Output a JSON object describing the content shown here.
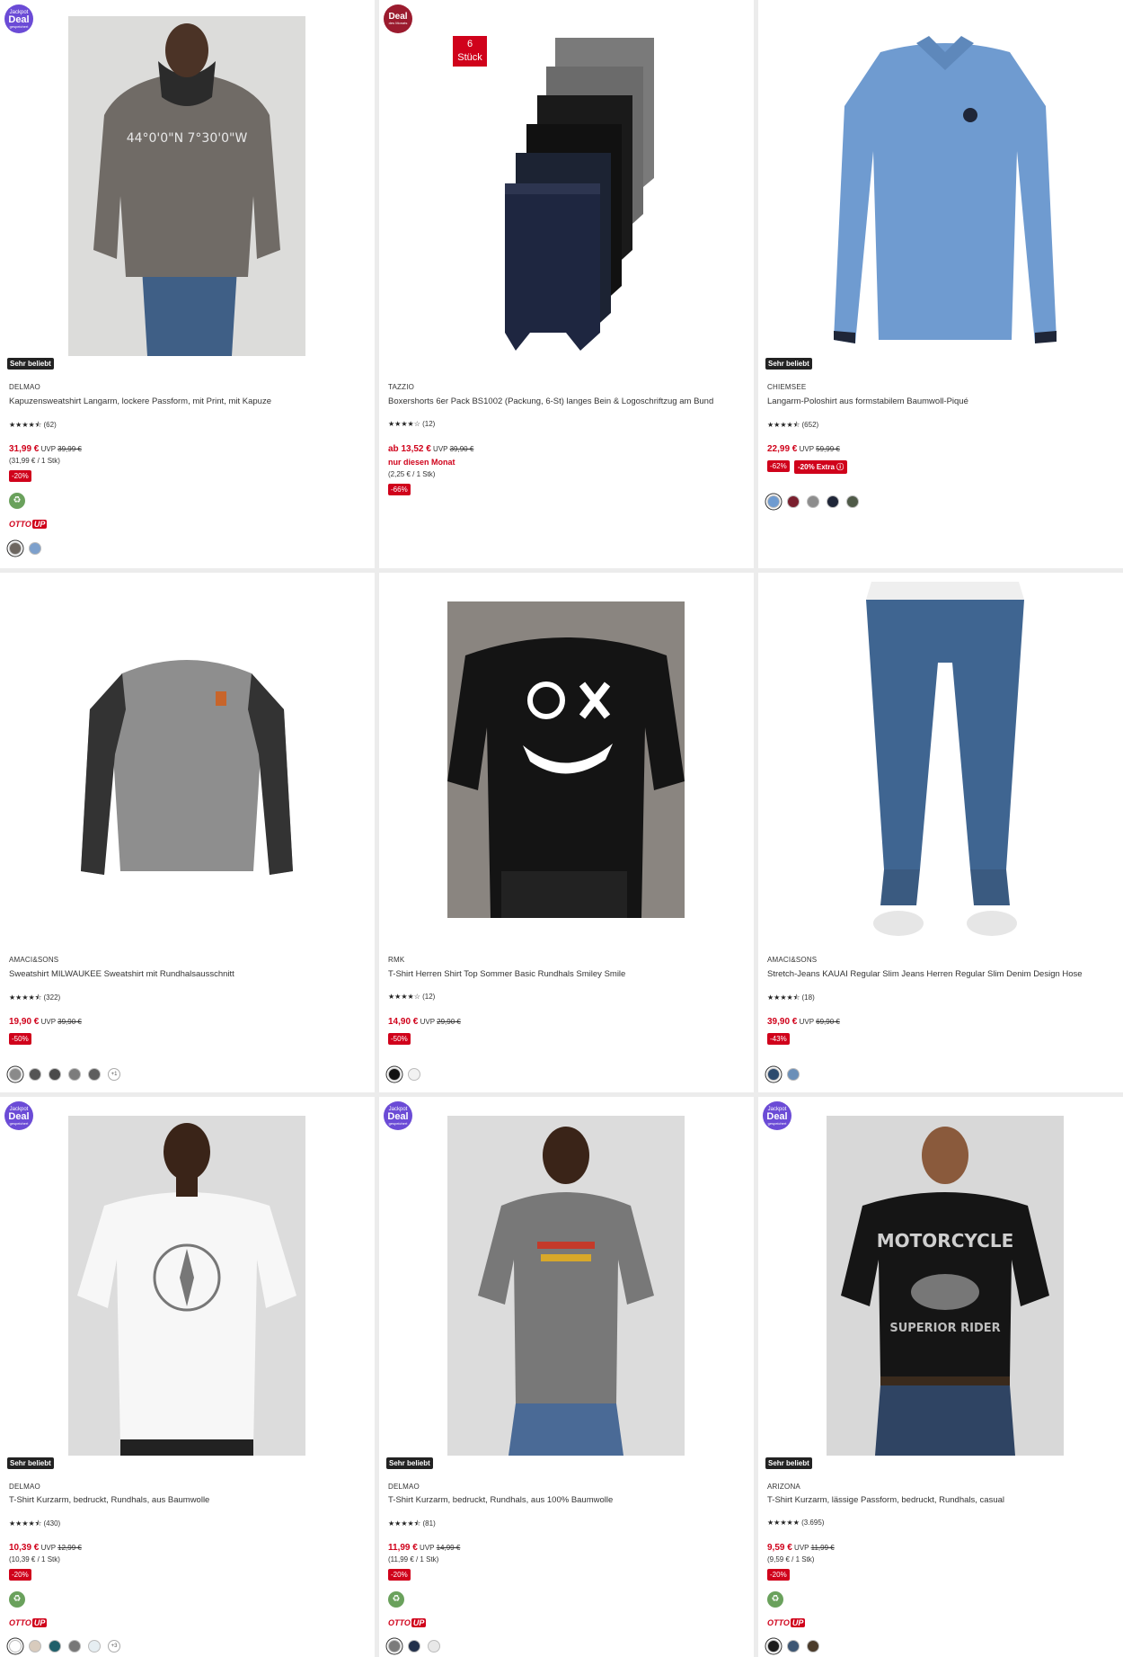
{
  "products": [
    {
      "badge": {
        "type": "jackpot",
        "l1": "Jackpot",
        "l2": "Deal",
        "l3": "gespeichert"
      },
      "popular": "Sehr beliebt",
      "brand": "DELMAO",
      "title": "Kapuzensweatshirt Langarm, lockere Passform, mit Print, mit Kapuze",
      "stars": "★★★★⯪",
      "reviews": "(62)",
      "price": "31,99 €",
      "uvp_label": "UVP",
      "uvp": "39,99 €",
      "unit": "(31,99 € / 1 Stk)",
      "discount": "-20%",
      "eco": true,
      "otto_up": {
        "a": "OTTO",
        "b": "UP"
      },
      "swatches": [
        "#6d6660",
        "#7da0cc"
      ],
      "selected": 0
    },
    {
      "badge": {
        "type": "deal",
        "l1": "Deal",
        "l2": "",
        "l3": "des Monats"
      },
      "pack": {
        "l1": "6",
        "l2": "Stück"
      },
      "brand": "TAZZIO",
      "title": "Boxershorts 6er Pack BS1002 (Packung, 6-St) langes Bein & Logoschriftzug am Bund",
      "stars": "★★★★☆",
      "reviews": "(12)",
      "price": "ab 13,52 €",
      "uvp_label": "UVP",
      "uvp": "39,90 €",
      "monat": "nur diesen Monat",
      "unit": "(2,25 € / 1 Stk)",
      "discount": "-66%"
    },
    {
      "popular": "Sehr beliebt",
      "brand": "CHIEMSEE",
      "title": "Langarm-Poloshirt aus formstabilem Baumwoll-Piqué",
      "stars": "★★★★⯪",
      "reviews": "(652)",
      "price": "22,99 €",
      "uvp_label": "UVP",
      "uvp": "59,99 €",
      "discount": "-62%",
      "extra": "-20% Extra ⓘ",
      "swatches": [
        "#6f9bd0",
        "#7a1f2e",
        "#8d8d8d",
        "#1f2638",
        "#4f5a48"
      ],
      "selected": 0
    },
    {
      "brand": "AMACI&SONS",
      "title": "Sweatshirt MILWAUKEE Sweatshirt mit Rundhalsausschnitt",
      "stars": "★★★★⯪",
      "reviews": "(322)",
      "price": "19,90 €",
      "uvp_label": "UVP",
      "uvp": "39,90 €",
      "discount": "-50%",
      "swatches": [
        "#8a8a8a",
        "#555555",
        "#4a4a4a",
        "#7c7c7c",
        "#5e5e5e"
      ],
      "selected": 0,
      "more": "+1"
    },
    {
      "brand": "RMK",
      "title": "T-Shirt Herren Shirt Top Sommer Basic Rundhals Smiley Smile",
      "stars": "★★★★☆",
      "reviews": "(12)",
      "price": "14,90 €",
      "uvp_label": "UVP",
      "uvp": "29,90 €",
      "discount": "-50%",
      "swatches": [
        "#111111",
        "#f2f2f2"
      ],
      "selected": 0
    },
    {
      "brand": "AMACI&SONS",
      "title": "Stretch-Jeans KAUAI Regular Slim Jeans Herren Regular Slim Denim Design Hose",
      "stars": "★★★★⯪",
      "reviews": "(18)",
      "price": "39,90 €",
      "uvp_label": "UVP",
      "uvp": "69,90 €",
      "discount": "-43%",
      "swatches": [
        "#2c4a6e",
        "#6b8fb8"
      ],
      "selected": 0
    },
    {
      "badge": {
        "type": "jackpot",
        "l1": "Jackpot",
        "l2": "Deal",
        "l3": "gespeichert"
      },
      "popular": "Sehr beliebt",
      "brand": "DELMAO",
      "title": "T-Shirt Kurzarm, bedruckt, Rundhals, aus Baumwolle",
      "stars": "★★★★⯪",
      "reviews": "(430)",
      "price": "10,39 €",
      "uvp_label": "UVP",
      "uvp": "12,99 €",
      "unit": "(10,39 € / 1 Stk)",
      "discount": "-20%",
      "eco": true,
      "otto_up": {
        "a": "OTTO",
        "b": "UP"
      },
      "swatches": [
        "#ffffff",
        "#d8cbbd",
        "#1f5f6a",
        "#777777",
        "#e6eef2"
      ],
      "selected": 0,
      "more": "+3"
    },
    {
      "badge": {
        "type": "jackpot",
        "l1": "Jackpot",
        "l2": "Deal",
        "l3": "gespeichert"
      },
      "popular": "Sehr beliebt",
      "brand": "DELMAO",
      "title": "T-Shirt Kurzarm, bedruckt, Rundhals, aus 100% Baumwolle",
      "stars": "★★★★⯪",
      "reviews": "(81)",
      "price": "11,99 €",
      "uvp_label": "UVP",
      "uvp": "14,99 €",
      "unit": "(11,99 € / 1 Stk)",
      "discount": "-20%",
      "eco": true,
      "otto_up": {
        "a": "OTTO",
        "b": "UP"
      },
      "swatches": [
        "#7b7b7b",
        "#22304a",
        "#e8e8e8"
      ],
      "selected": 0
    },
    {
      "badge": {
        "type": "jackpot",
        "l1": "Jackpot",
        "l2": "Deal",
        "l3": "gespeichert"
      },
      "popular": "Sehr beliebt",
      "brand": "ARIZONA",
      "title": "T-Shirt Kurzarm, lässige Passform, bedruckt, Rundhals, casual",
      "stars": "★★★★★",
      "reviews": "(3.695)",
      "price": "9,59 €",
      "uvp_label": "UVP",
      "uvp": "11,99 €",
      "unit": "(9,59 € / 1 Stk)",
      "discount": "-20%",
      "eco": true,
      "otto_up": {
        "a": "OTTO",
        "b": "UP"
      },
      "swatches": [
        "#1b1b1b",
        "#3d5673",
        "#4a3b2a"
      ],
      "selected": 0
    }
  ]
}
